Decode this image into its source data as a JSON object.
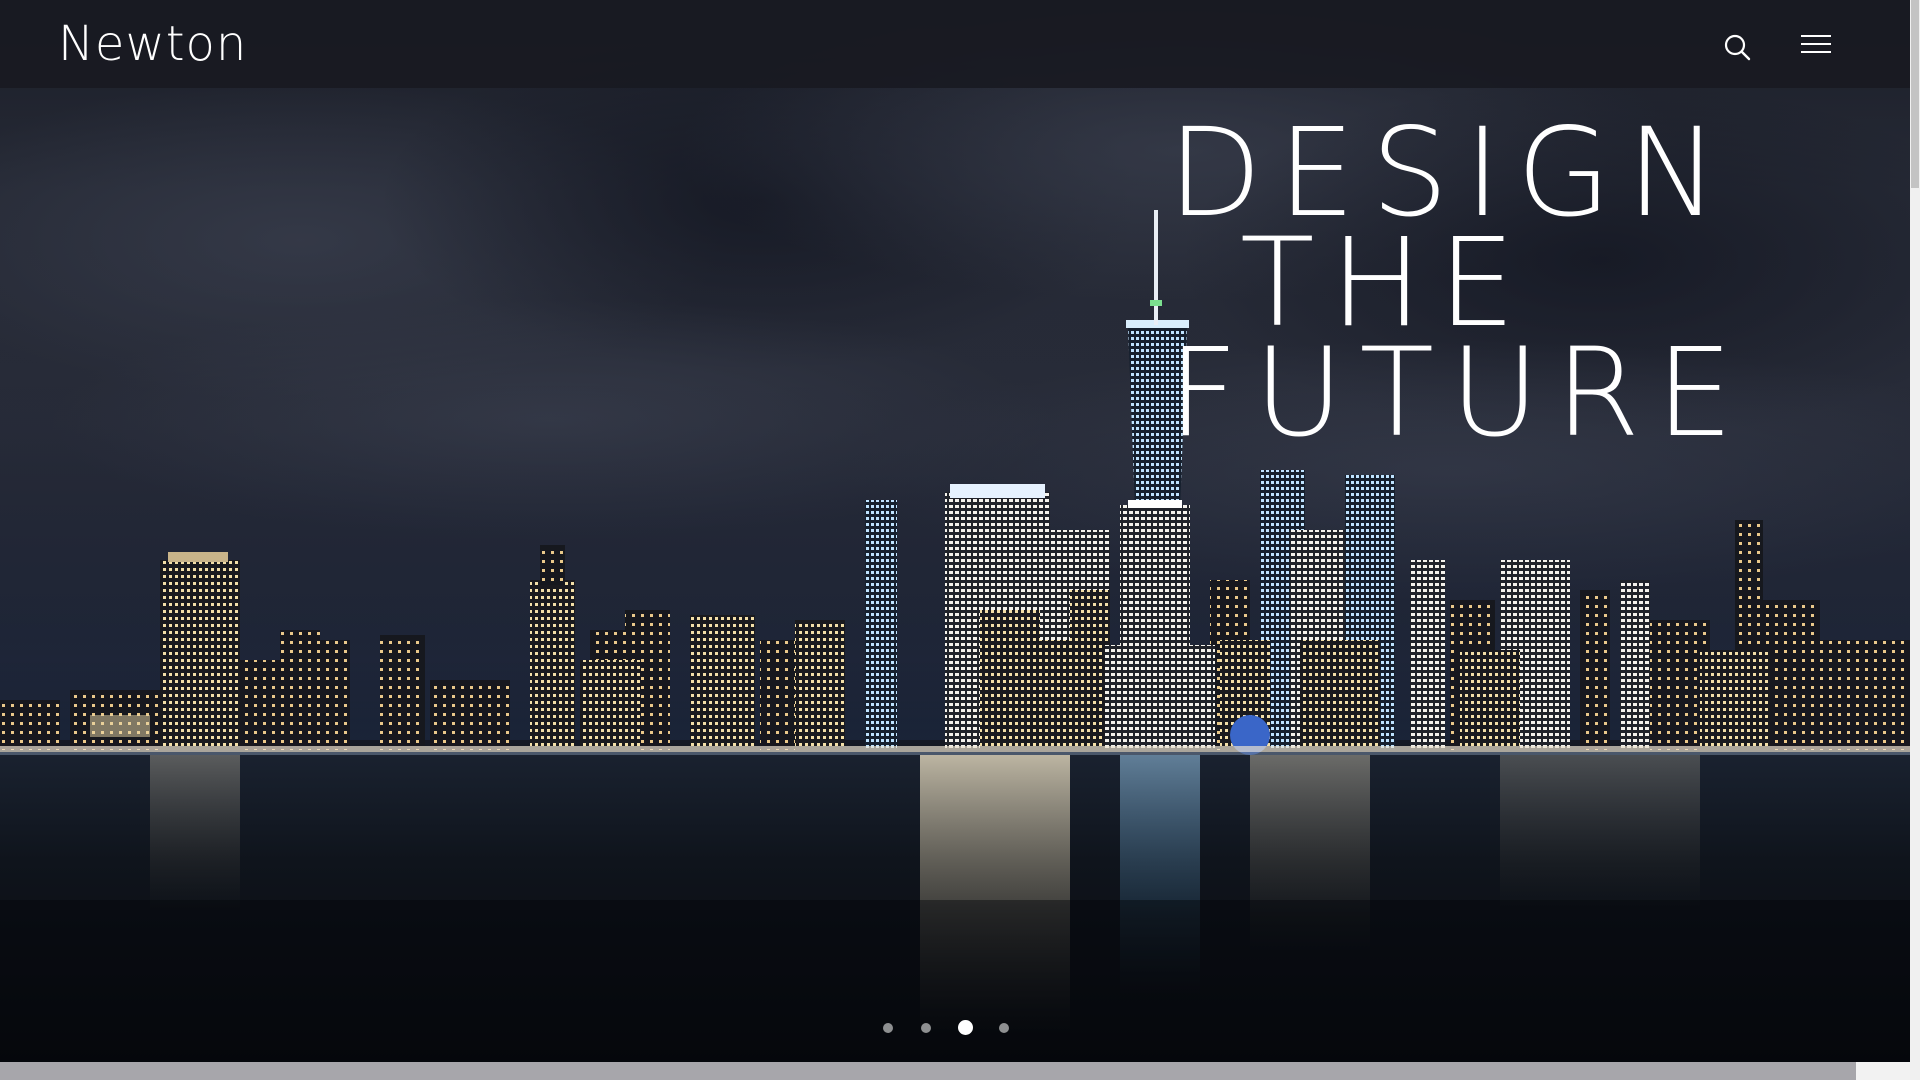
{
  "site": {
    "logo_text": "Newton"
  },
  "header": {
    "search_icon": "search-icon",
    "menu_icon": "hamburger-menu-icon"
  },
  "hero": {
    "headline_lines": [
      "DESIGN",
      "THE",
      "FUTURE"
    ],
    "background": "night-city-skyline-over-water"
  },
  "slider": {
    "dot_count": 4,
    "active_index": 2
  },
  "colors": {
    "text": "#ffffff",
    "topbar": "#181a21",
    "bottom_strip": "#a7a6ab"
  }
}
